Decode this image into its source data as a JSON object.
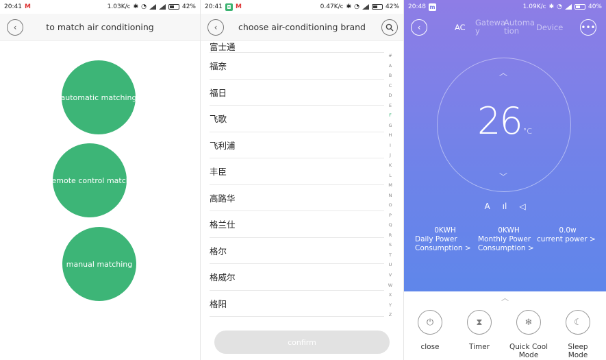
{
  "screen1": {
    "status": {
      "time": "20:41",
      "speed": "1.03K/c",
      "battery": "42%"
    },
    "title": "to match air conditioning",
    "buttons": [
      "automatic matching",
      "remote control match",
      "manual matching"
    ]
  },
  "screen2": {
    "status": {
      "time": "20:41",
      "speed": "0.47K/c",
      "battery": "42%"
    },
    "title": "choose air-conditioning brand",
    "brands": [
      "富士通",
      "福奈",
      "福日",
      "飞歌",
      "飞利浦",
      "丰臣",
      "高路华",
      "格兰仕",
      "格尔",
      "格威尔",
      "格阳"
    ],
    "alphabet": [
      "#",
      "A",
      "B",
      "C",
      "D",
      "E",
      "F",
      "G",
      "H",
      "I",
      "J",
      "K",
      "L",
      "M",
      "N",
      "O",
      "P",
      "Q",
      "R",
      "S",
      "T",
      "U",
      "V",
      "W",
      "X",
      "Y",
      "Z"
    ],
    "active_letter": "F",
    "confirm_label": "confirm"
  },
  "screen3": {
    "status": {
      "time": "20:48",
      "speed": "1.09K/c",
      "battery": "40%"
    },
    "tabs": {
      "ac": "AC",
      "gateway": "Gatewa y",
      "automation": "Automa tion",
      "device": "Device"
    },
    "temperature": "26",
    "unit": "°C",
    "modes": [
      "A",
      "ıl",
      "◁"
    ],
    "stats": [
      {
        "value": "0KWH",
        "label": "Daily Power Consumption >"
      },
      {
        "value": "0KWH",
        "label": "Monthly Power Consumption >"
      },
      {
        "value": "0.0w",
        "label": "current power >"
      }
    ],
    "controls": [
      {
        "icon": "⏻",
        "label": "close"
      },
      {
        "icon": "⧗",
        "label": "Timer"
      },
      {
        "icon": "❄",
        "label": "Quick Cool Mode"
      },
      {
        "icon": "☾",
        "label": "Sleep Mode"
      }
    ],
    "colors": {
      "gradient_top": "#8e7de6",
      "gradient_bottom": "#5f86ea",
      "accent_green": "#3db577"
    }
  }
}
